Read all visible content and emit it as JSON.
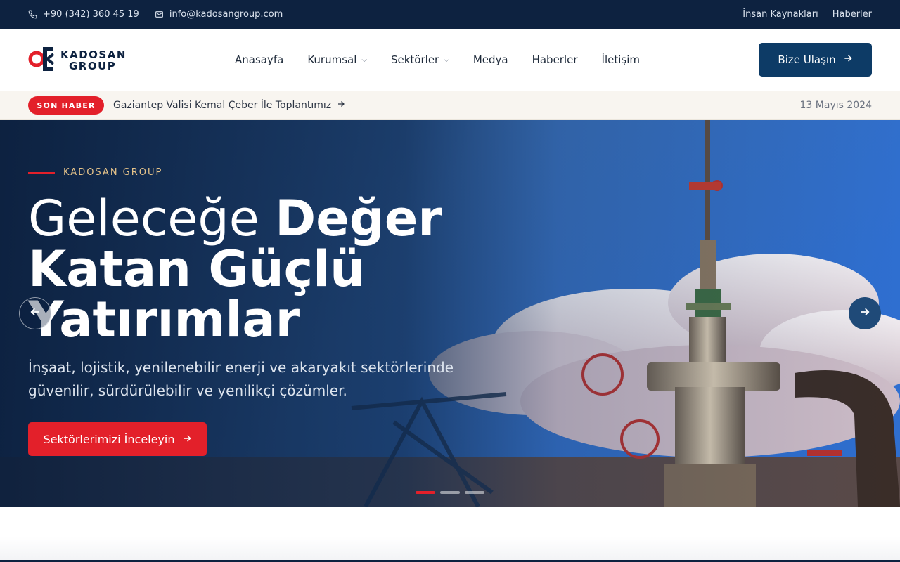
{
  "topbar": {
    "phone": "+90 (342) 360 45 19",
    "email": "info@kadosangroup.com",
    "links": [
      "İnsan Kaynakları",
      "Haberler"
    ]
  },
  "header": {
    "logo": {
      "line1": "KADOSAN",
      "line2": "GROUP"
    },
    "nav": [
      {
        "label": "Anasayfa",
        "dropdown": false
      },
      {
        "label": "Kurumsal",
        "dropdown": true
      },
      {
        "label": "Sektörler",
        "dropdown": true
      },
      {
        "label": "Medya",
        "dropdown": false
      },
      {
        "label": "Haberler",
        "dropdown": false
      },
      {
        "label": "İletişim",
        "dropdown": false
      }
    ],
    "cta_label": "Bize Ulaşın"
  },
  "ticker": {
    "badge": "SON HABER",
    "headline": "Gaziantep Valisi Kemal Çeber İle Toplantımız",
    "date": "13 Mayıs 2024"
  },
  "hero": {
    "eyebrow": "KADOSAN GROUP",
    "title_light": "Geleceğe ",
    "title_bold": "Değer Katan Güçlü Yatırımlar",
    "subtitle": "İnşaat, lojistik, yenilenebilir enerji ve akaryakıt sektörlerinde güvenilir, sürdürülebilir ve yenilikçi çözümler.",
    "button_label": "Sektörlerimizi İnceleyin",
    "slides_total": 3,
    "active_slide": 1
  },
  "colors": {
    "navy": "#0d2240",
    "cta_blue": "#0d3b66",
    "accent_red": "#e3202a",
    "eyebrow_gold": "#e7c48a"
  }
}
